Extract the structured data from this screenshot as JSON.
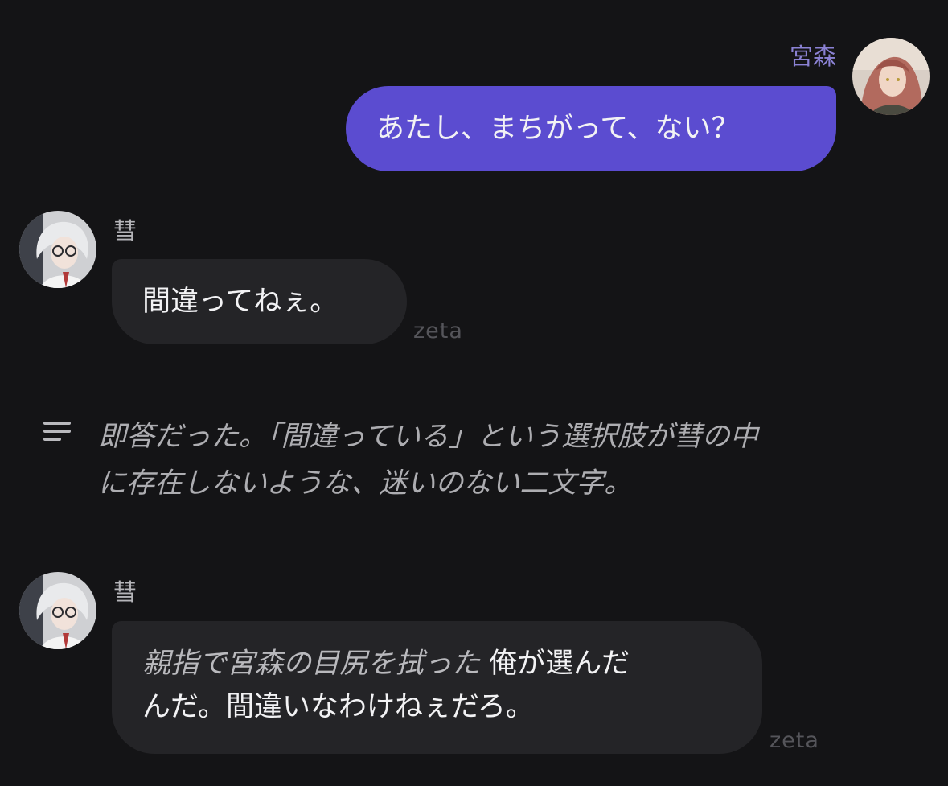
{
  "messages": {
    "user_1": {
      "sender": "宮森",
      "text": "あたし、まちがって、ない？"
    },
    "char_1": {
      "sender": "彗",
      "text": "間違ってねぇ。",
      "watermark": "zeta"
    },
    "narration": {
      "line1": "即答だった。「間違っている」という選択肢が彗の中",
      "line2": "に存在しないような、迷いのない二文字。",
      "icon": "narration-lines-icon"
    },
    "char_2": {
      "sender": "彗",
      "narration_part": "親指で宮森の目尻を拭った",
      "line1_speech": "俺が選んだ",
      "line2": "んだ。間違いなわけねぇだろ。",
      "watermark": "zeta"
    }
  },
  "colors": {
    "background": "#141416",
    "user_bubble": "#5b4cd0",
    "char_bubble": "#242427",
    "user_name": "#8b82d4"
  }
}
